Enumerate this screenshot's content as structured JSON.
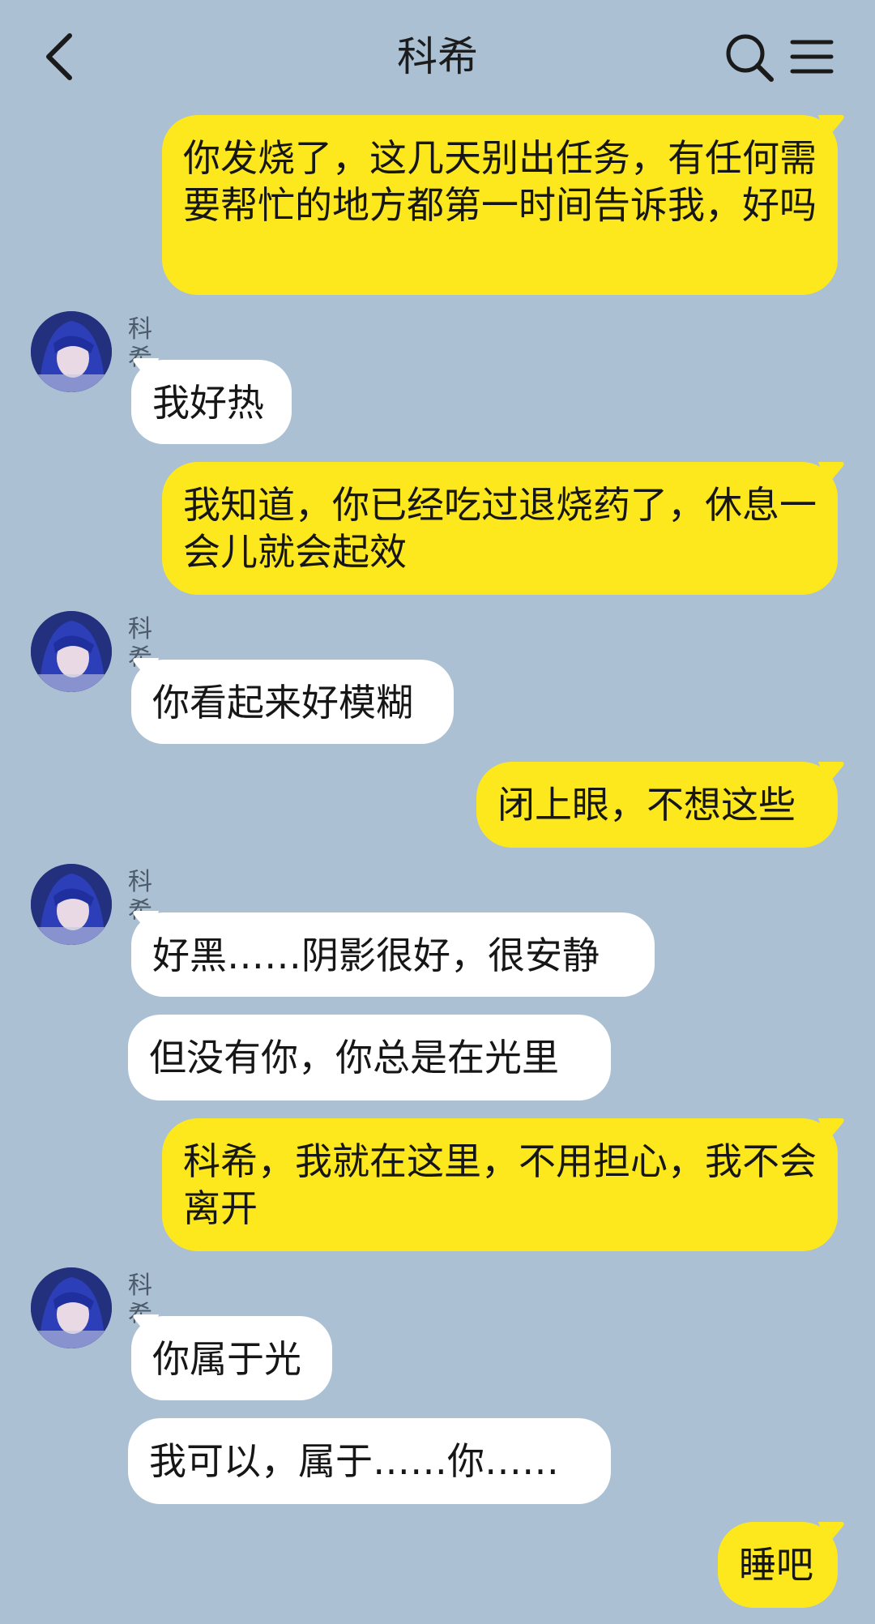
{
  "header": {
    "title": "科希",
    "back_icon": "chevron-left-icon",
    "search_icon": "search-icon",
    "menu_icon": "menu-icon"
  },
  "colors": {
    "background": "#abc0d3",
    "my_bubble": "#fde81e",
    "their_bubble": "#ffffff"
  },
  "messages": [
    {
      "from": "me",
      "text": "你发烧了，这几天别出任务，有任何需要帮忙的地方都第一时间告诉我，好吗"
    },
    {
      "from": "other",
      "sender": "科希",
      "text": "我好热"
    },
    {
      "from": "me",
      "text": "我知道，你已经吃过退烧药了，休息一会儿就会起效"
    },
    {
      "from": "other",
      "sender": "科希",
      "text": "你看起来好模糊"
    },
    {
      "from": "me",
      "text": "闭上眼，不想这些"
    },
    {
      "from": "other",
      "sender": "科希",
      "text": "好黑……阴影很好，很安静"
    },
    {
      "from": "other",
      "text": "但没有你，你总是在光里"
    },
    {
      "from": "me",
      "text": "科希，我就在这里，不用担心，我不会离开"
    },
    {
      "from": "other",
      "sender": "科希",
      "text": "你属于光"
    },
    {
      "from": "other",
      "text": "我可以，属于……你……"
    },
    {
      "from": "me",
      "text": "睡吧"
    }
  ]
}
